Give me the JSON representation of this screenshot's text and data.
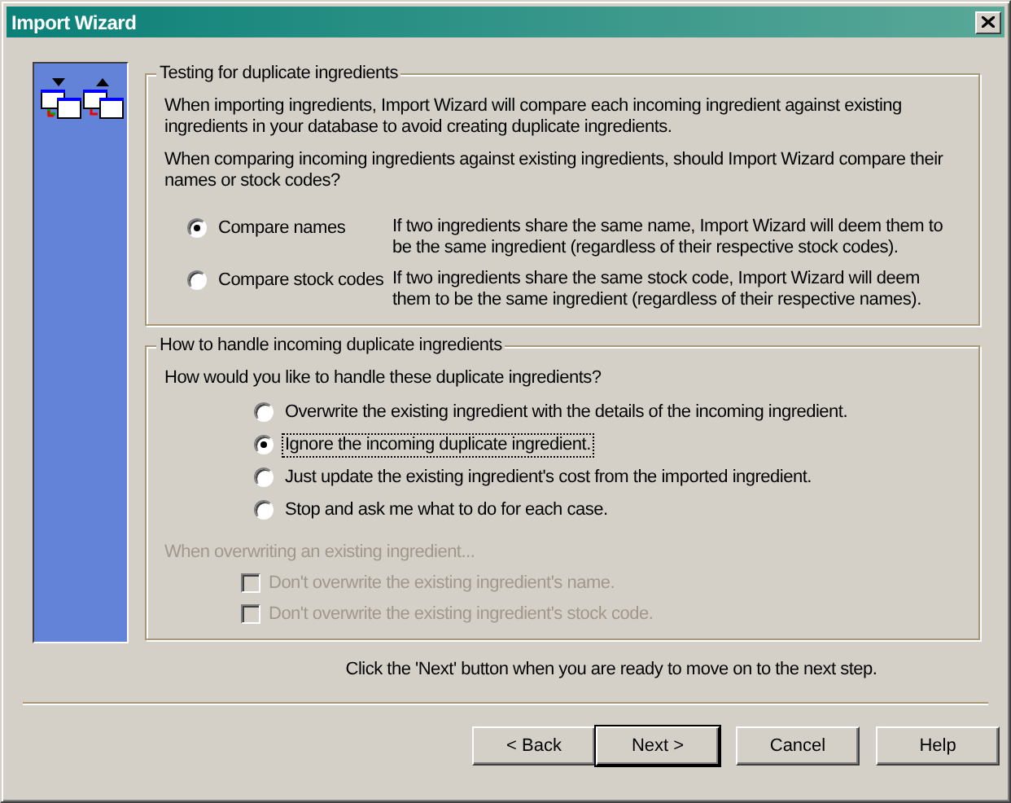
{
  "window": {
    "title": "Import Wizard"
  },
  "duplicate_test": {
    "title": "Testing for duplicate ingredients",
    "intro": "When importing ingredients, Import Wizard will compare each incoming ingredient against existing ingredients in your database to avoid creating duplicate ingredients.",
    "question": "When comparing incoming ingredients against existing ingredients, should Import Wizard compare their names or stock codes?",
    "options": [
      {
        "label": "Compare names",
        "selected": true,
        "description": "If two ingredients share the same name, Import Wizard will deem them to be the same ingredient (regardless of their respective stock codes)."
      },
      {
        "label": "Compare stock codes",
        "selected": false,
        "description": "If two ingredients share the same stock code, Import Wizard will deem them to be the same ingredient (regardless of their respective names)."
      }
    ]
  },
  "duplicate_handling": {
    "title": "How to handle incoming duplicate ingredients",
    "question": "How would you like to handle these duplicate ingredients?",
    "options": [
      {
        "label": "Overwrite the existing ingredient with the details of the incoming ingredient.",
        "selected": false
      },
      {
        "label": "Ignore the incoming duplicate ingredient.",
        "selected": true
      },
      {
        "label": "Just update the existing ingredient's cost from the imported ingredient.",
        "selected": false
      },
      {
        "label": "Stop and ask me what to do for each case.",
        "selected": false
      }
    ],
    "overwrite_heading": {
      "text": "When overwriting an existing ingredient...",
      "disabled": true
    },
    "overwrite_options": [
      {
        "label": "Don't overwrite the existing ingredient's name.",
        "checked": false,
        "disabled": true
      },
      {
        "label": "Don't overwrite the existing ingredient's stock code.",
        "checked": false,
        "disabled": true
      }
    ]
  },
  "hint": "Click the 'Next' button when you are ready to move on to the next step.",
  "buttons": [
    {
      "label": "< Back",
      "default": false
    },
    {
      "label": "Next >",
      "default": true
    },
    {
      "label": "Cancel",
      "default": false
    },
    {
      "label": "Help",
      "default": false
    }
  ]
}
